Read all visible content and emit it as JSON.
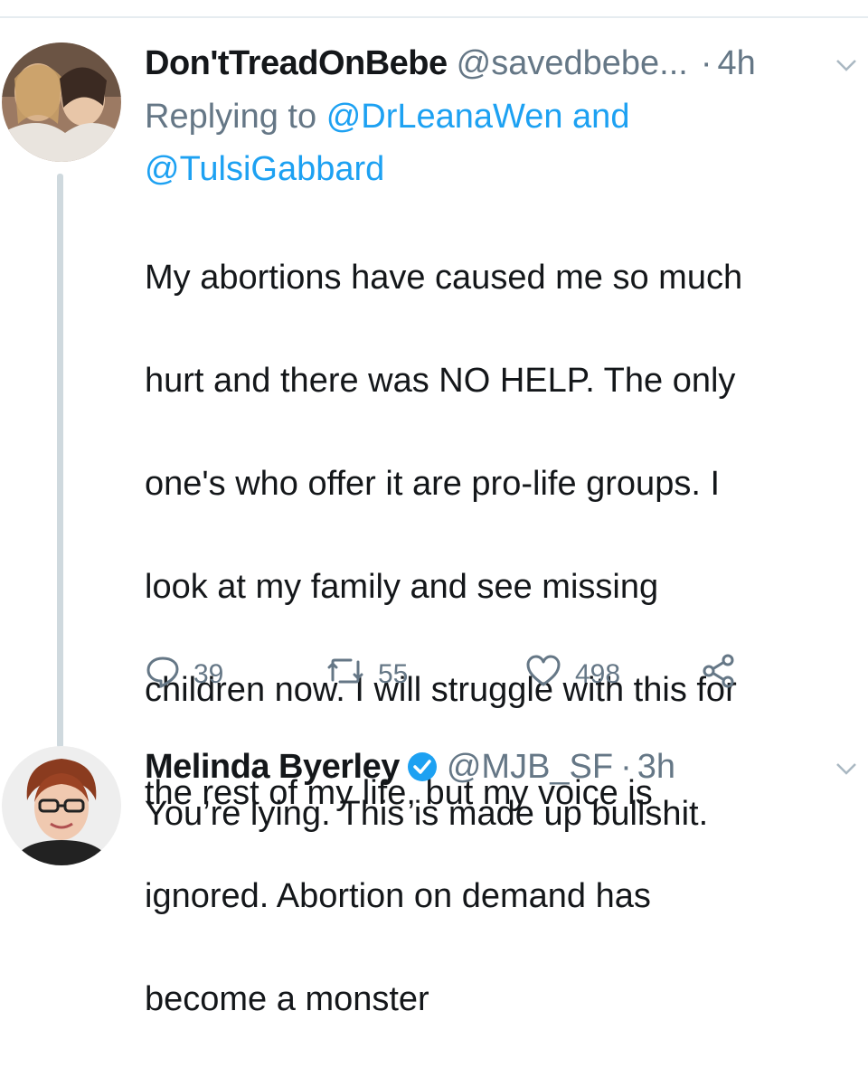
{
  "tweet1": {
    "display_name": "Don'tTreadOnBebe",
    "handle": "@savedbebe...",
    "separator": "·",
    "time": "4h",
    "replying_prefix": "Replying to",
    "replying_mention1": "@DrLeanaWen",
    "replying_and": "and",
    "replying_mention2": "@TulsiGabbard",
    "text_lines": [
      "My abortions have caused me so much",
      "hurt and there was NO HELP. The only",
      "one's who offer it are pro-life groups. I",
      "look at my family and see missing",
      "children now. I will struggle with this for",
      "the rest of my life, but my voice is",
      "ignored.  Abortion on demand has",
      "become a monster"
    ],
    "actions": {
      "reply_count": "39",
      "retweet_count": "55",
      "like_count": "498"
    }
  },
  "tweet2": {
    "display_name": "Melinda Byerley",
    "handle": "@MJB_SF",
    "separator": "·",
    "time": "3h",
    "text": "You’re lying. This is made up bullshit."
  },
  "colors": {
    "link": "#1da1f2",
    "secondary": "#657786",
    "thread_line": "#cfd9de"
  },
  "icons": [
    "reply-icon",
    "retweet-icon",
    "like-icon",
    "share-icon",
    "chevron-down-icon",
    "verified-badge-icon"
  ]
}
